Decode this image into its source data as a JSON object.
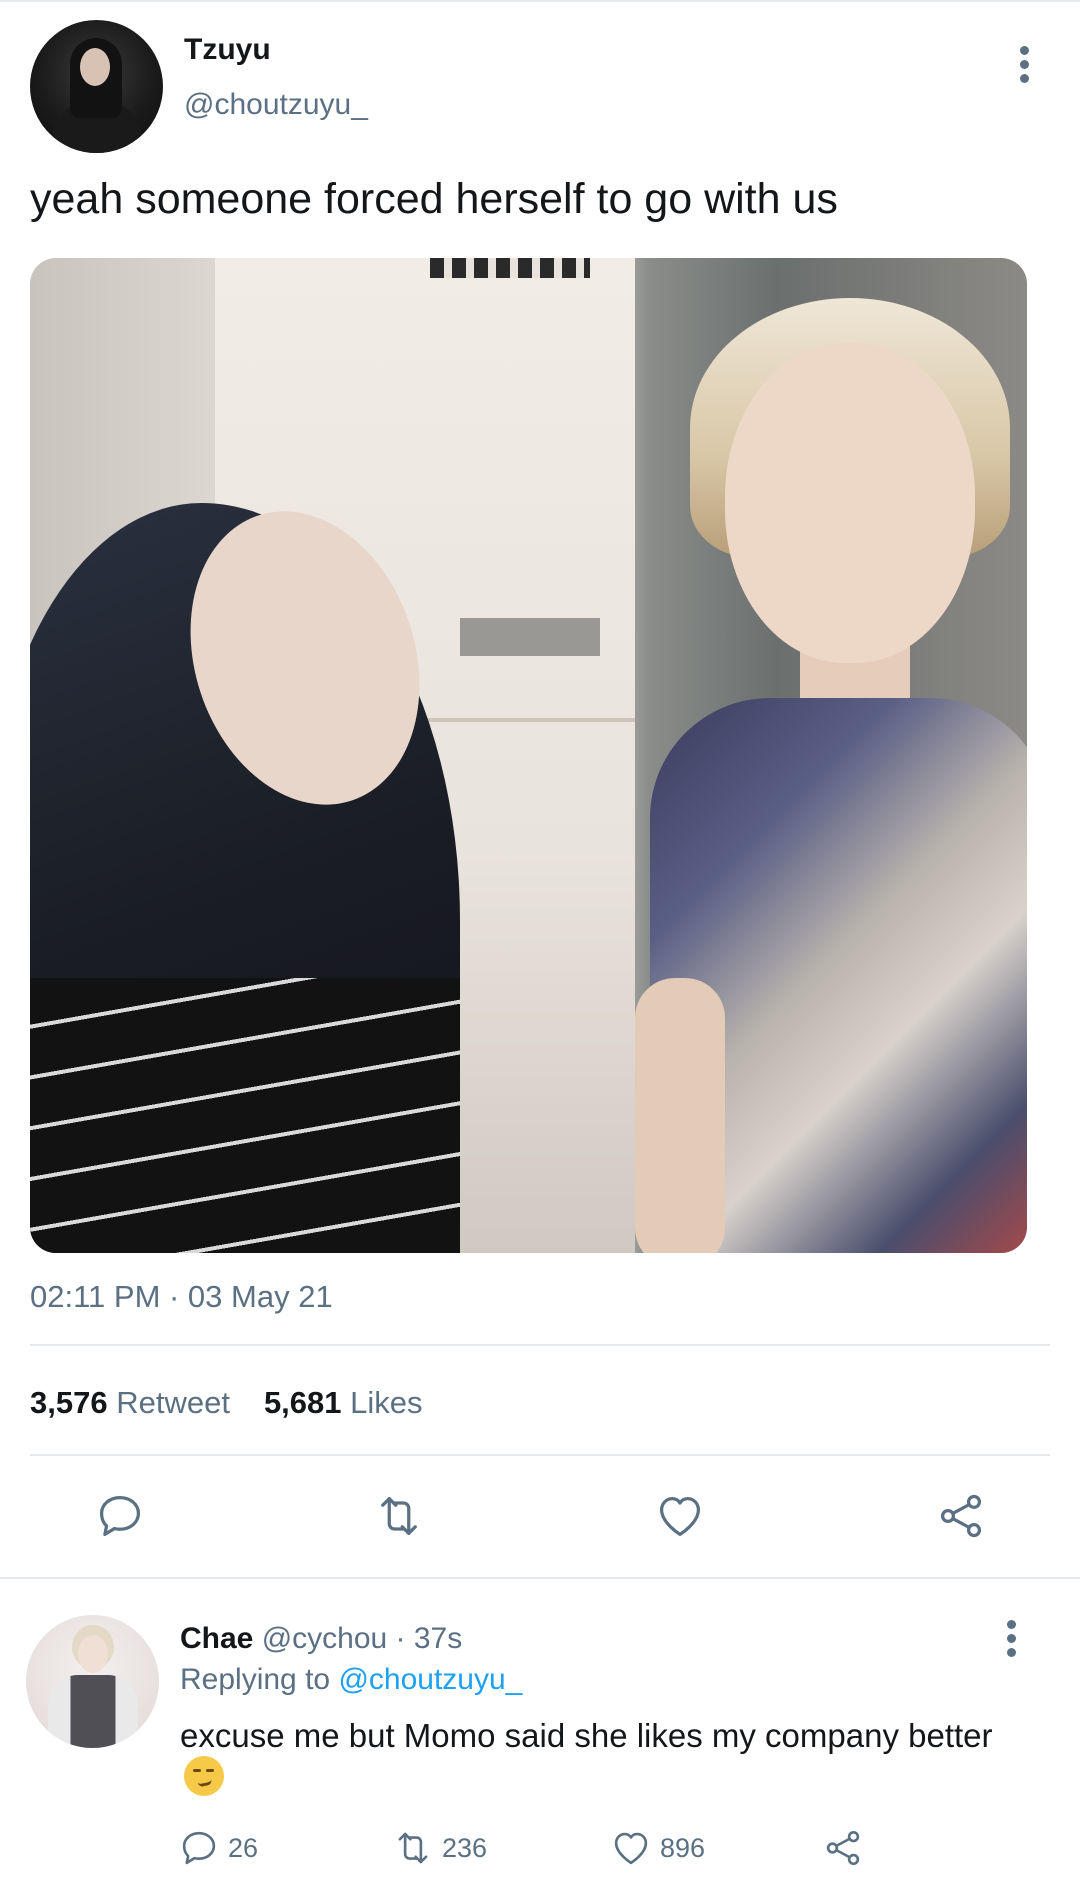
{
  "tweet": {
    "author_name": "Tzuyu",
    "author_handle": "@choutzuyu_",
    "text": "yeah someone forced herself to go with us",
    "timestamp": "02:11 PM · 03 May 21",
    "retweet_count": "3,576",
    "retweet_label": "Retweet",
    "like_count": "5,681",
    "like_label": "Likes",
    "actions": [
      "reply-icon",
      "retweet-icon",
      "like-icon",
      "share-icon"
    ]
  },
  "reply": {
    "author_name": "Chae",
    "author_handle_time": "@cychou · 37s",
    "replying_prefix": "Replying to",
    "replying_to": "@choutzuyu_",
    "text": "excuse me but Momo said she likes my company better",
    "reply_count": "26",
    "retweet_count": "236",
    "like_count": "896"
  },
  "colors": {
    "text_primary": "#14171a",
    "text_secondary": "#5b7083",
    "link": "#1da1f2",
    "divider": "#e6e9ec"
  }
}
